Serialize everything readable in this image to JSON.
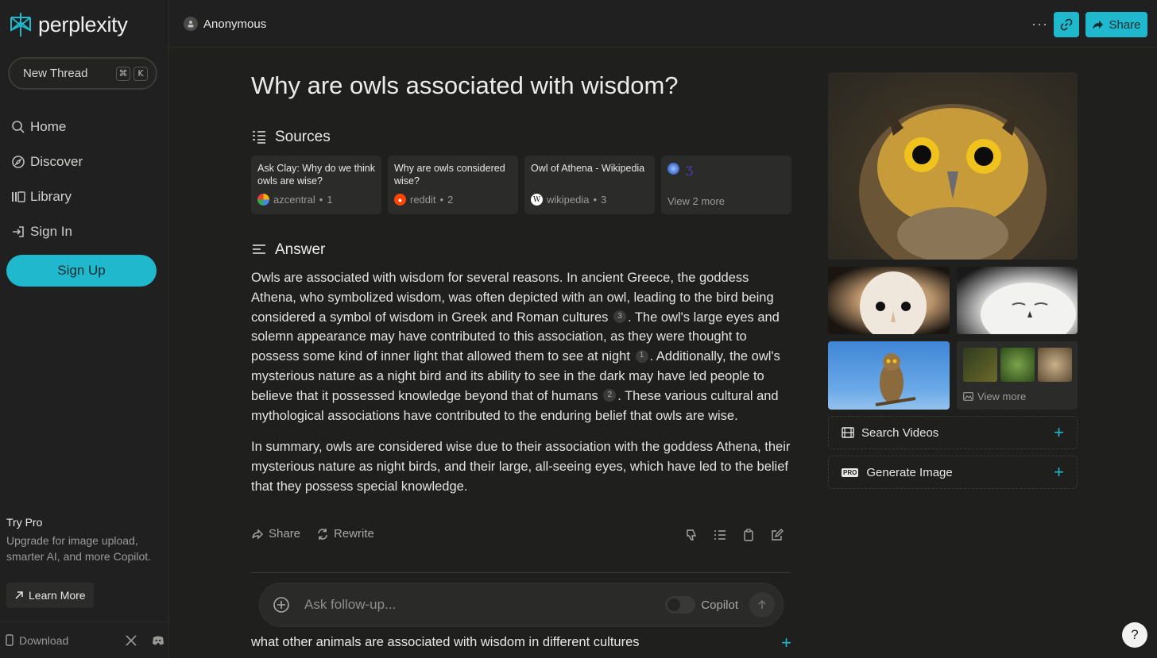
{
  "brand": {
    "name": "perplexity",
    "accent": "#20b8cd"
  },
  "sidebar": {
    "new_thread": {
      "label": "New Thread",
      "shortcut_keys": [
        "⌘",
        "K"
      ]
    },
    "nav": [
      {
        "label": "Home",
        "icon": "search-icon"
      },
      {
        "label": "Discover",
        "icon": "compass-icon"
      },
      {
        "label": "Library",
        "icon": "library-icon"
      },
      {
        "label": "Sign In",
        "icon": "sign-in-icon"
      }
    ],
    "sign_up": "Sign Up",
    "try_pro": {
      "title": "Try Pro",
      "text": "Upgrade for image upload, smarter AI, and more Copilot.",
      "button": "Learn More"
    },
    "footer": {
      "download": "Download"
    }
  },
  "topbar": {
    "user": "Anonymous",
    "more": "···",
    "share": "Share"
  },
  "thread": {
    "question": "Why are owls associated with wisdom?",
    "sources_heading": "Sources",
    "sources": [
      {
        "title": "Ask Clay: Why do we think owls are wise?",
        "site": "azcentral",
        "index": "1"
      },
      {
        "title": "Why are owls considered wise?",
        "site": "reddit",
        "index": "2"
      },
      {
        "title": "Owl of Athena - Wikipedia",
        "site": "wikipedia",
        "index": "3"
      }
    ],
    "sources_more": "View 2 more",
    "answer_heading": "Answer",
    "answer": {
      "p1_a": "Owls are associated with wisdom for several reasons. In ancient Greece, the goddess Athena, who symbolized wisdom, was often depicted with an owl, leading to the bird being considered a symbol of wisdom in Greek and Roman cultures",
      "p1_c1": "3",
      "p1_b": ". The owl's large eyes and solemn appearance may have contributed to this association, as they were thought to possess some kind of inner light that allowed them to see at night",
      "p1_c2": "1",
      "p1_c": ". Additionally, the owl's mysterious nature as a night bird and its ability to see in the dark may have led people to believe that it possessed knowledge beyond that of humans",
      "p1_c3": "2",
      "p1_d": ". These various cultural and mythological associations have contributed to the enduring belief that owls are wise.",
      "p2": "In summary, owls are considered wise due to their association with the goddess Athena, their mysterious nature as night birds, and their large, all-seeing eyes, which have led to the belief that they possess special knowledge."
    },
    "actions": {
      "share": "Share",
      "rewrite": "Rewrite"
    },
    "followup": {
      "placeholder": "Ask follow-up...",
      "copilot": "Copilot"
    },
    "related": "what other animals are associated with wisdom in different cultures"
  },
  "media": {
    "view_more": "View more",
    "search_videos": "Search Videos",
    "generate_image": "Generate Image",
    "pro_badge": "PRO"
  },
  "help": "?"
}
